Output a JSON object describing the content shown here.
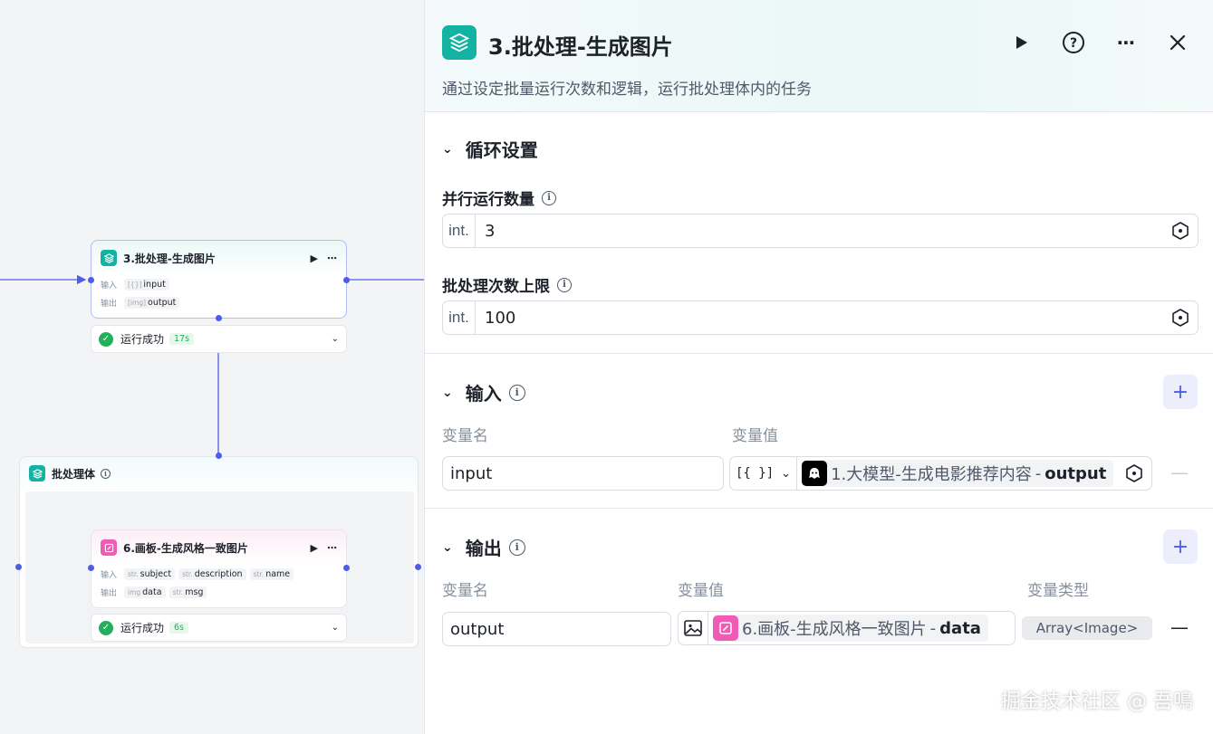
{
  "colors": {
    "accent": "#4e5de8",
    "batch": "#14b2a2",
    "canvas_node": "#f05bb5",
    "success": "#21b15a"
  },
  "canvas": {
    "batch_node": {
      "title": "3.批处理-生成图片",
      "input_label": "输入",
      "output_label": "输出",
      "inputs": [
        {
          "type": "[{}]",
          "name": "input"
        }
      ],
      "outputs": [
        {
          "type": "[img]",
          "name": "output"
        }
      ],
      "status": "运行成功",
      "duration": "17s"
    },
    "batch_body": {
      "title": "批处理体"
    },
    "paint_node": {
      "title": "6.画板-生成风格一致图片",
      "input_label": "输入",
      "output_label": "输出",
      "inputs": [
        {
          "type": "str.",
          "name": "subject"
        },
        {
          "type": "str.",
          "name": "description"
        },
        {
          "type": "str.",
          "name": "name"
        }
      ],
      "outputs": [
        {
          "type": "img",
          "name": "data"
        },
        {
          "type": "str.",
          "name": "msg"
        }
      ],
      "status": "运行成功",
      "duration": "6s"
    }
  },
  "panel": {
    "title": "3.批处理-生成图片",
    "description": "通过设定批量运行次数和逻辑，运行批处理体内的任务",
    "icons": [
      "play-icon",
      "help-icon",
      "more-icon",
      "close-icon"
    ],
    "loop_section": {
      "title": "循环设置",
      "parallel": {
        "label": "并行运行数量",
        "prefix": "int.",
        "value": "3"
      },
      "max_runs": {
        "label": "批处理次数上限",
        "prefix": "int.",
        "value": "100"
      }
    },
    "input_section": {
      "title": "输入",
      "col_name": "变量名",
      "col_value": "变量值",
      "row": {
        "name": "input",
        "type": "[{ }]",
        "ref_node": "1.大模型-生成电影推荐内容",
        "ref_sep": "-",
        "ref_var": "output"
      }
    },
    "output_section": {
      "title": "输出",
      "col_name": "变量名",
      "col_value": "变量值",
      "col_type": "变量类型",
      "row": {
        "name": "output",
        "ref_node": "6.画板-生成风格一致图片",
        "ref_sep": "-",
        "ref_var": "data",
        "var_type": "Array<Image>"
      }
    }
  },
  "watermark": "掘金技术社区 @ 吾鳴"
}
